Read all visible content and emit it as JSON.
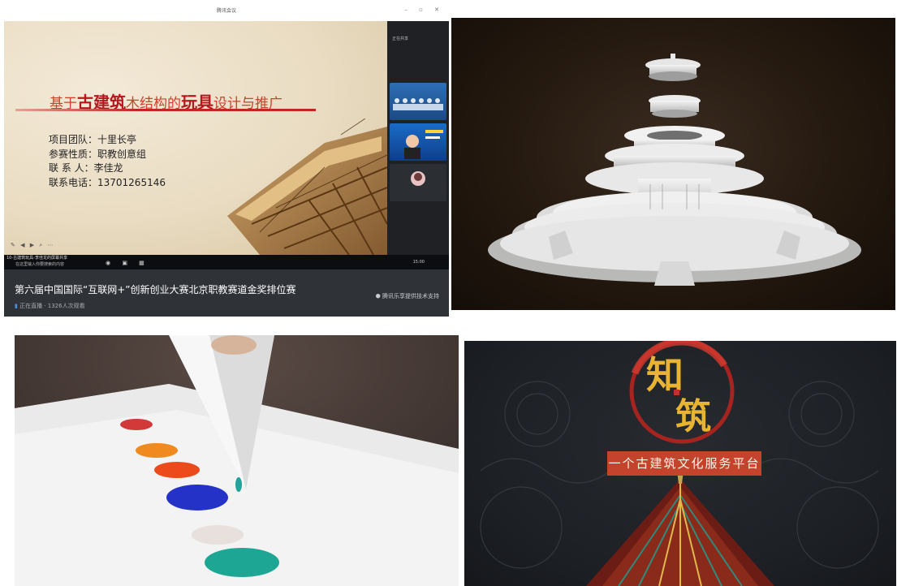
{
  "meeting": {
    "window_title": "腾讯会议",
    "slide": {
      "title_part1": "基于",
      "title_part2": "古建筑",
      "title_part3": "木结构的",
      "title_part4": "玩具",
      "title_part5": "设计与推广",
      "info_lines": [
        "项目团队：十里长亭",
        "参赛性质：职教创意组",
        "联 系 人：李佳龙",
        "联系电话：13701265146"
      ]
    },
    "sidebar_header": "正在共享",
    "taskbar_title": "10-古建筑玩具-李佳龙的屏幕共享",
    "taskbar_search": "在这里输入你要搜索的内容",
    "taskbar_time": "15:00",
    "footer_title": "第六届中国国际“互联网+”创新创业大赛北京职教赛道金奖排位赛",
    "live_status": "正在直播 · 1326人次观看",
    "support_text": "腾讯乐享提供技术支持"
  },
  "poster": {
    "logo_char1": "知",
    "logo_char2": "筑",
    "banner": "一个古建筑文化服务平台"
  },
  "colors": {
    "slide_red": "#b5171d",
    "footer_bg": "#2f3237",
    "banner_red": "#c4432d",
    "logo_gold": "#e8b431"
  }
}
